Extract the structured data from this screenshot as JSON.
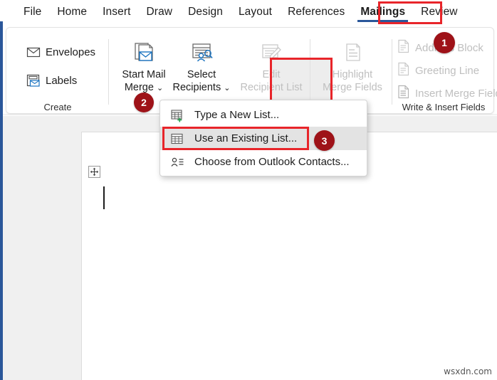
{
  "window": {
    "accent_blue": "#2b579a",
    "highlight_red": "#e8252a",
    "badge_red": "#9e1218"
  },
  "tabs": [
    {
      "label": "File",
      "active": false
    },
    {
      "label": "Home",
      "active": false
    },
    {
      "label": "Insert",
      "active": false
    },
    {
      "label": "Draw",
      "active": false
    },
    {
      "label": "Design",
      "active": false
    },
    {
      "label": "Layout",
      "active": false
    },
    {
      "label": "References",
      "active": false
    },
    {
      "label": "Mailings",
      "active": true
    },
    {
      "label": "Review",
      "active": false
    }
  ],
  "ribbon": {
    "groups": [
      {
        "name": "create",
        "label": "Create"
      },
      {
        "name": "start_mail_merge",
        "label": ""
      },
      {
        "name": "write_insert",
        "label": "Write & Insert Fields"
      }
    ],
    "envelopes": {
      "label": "Envelopes",
      "icon": "envelope-icon"
    },
    "labels": {
      "label": "Labels",
      "icon": "label-icon"
    },
    "start_mail_merge": {
      "line1": "Start Mail",
      "line2": "Merge",
      "chevron": "⌄",
      "icon": "start-mail-merge-icon"
    },
    "select_recipients": {
      "line1": "Select",
      "line2": "Recipients",
      "chevron": "⌄",
      "icon": "select-recipients-icon"
    },
    "edit_recipient_list": {
      "line1": "Edit",
      "line2": "Recipient List",
      "icon": "edit-recipient-list-icon"
    },
    "highlight_merge_fields": {
      "line1": "Highlight",
      "line2": "Merge Fields",
      "icon": "highlight-merge-fields-icon"
    },
    "address_block": {
      "label": "Address Block",
      "icon": "address-block-icon"
    },
    "greeting_line": {
      "label": "Greeting Line",
      "icon": "greeting-line-icon"
    },
    "insert_merge_field": {
      "label": "Insert Merge Field",
      "chevron": "⌄",
      "icon": "insert-merge-field-icon"
    }
  },
  "dropdown": {
    "items": [
      {
        "label": "Type a New List...",
        "icon": "new-list-icon",
        "hover": false
      },
      {
        "label": "Use an Existing List...",
        "icon": "existing-list-icon",
        "hover": true
      },
      {
        "label": "Choose from Outlook Contacts...",
        "icon": "outlook-contacts-icon",
        "hover": false
      }
    ]
  },
  "badges": [
    {
      "number": "1"
    },
    {
      "number": "2"
    },
    {
      "number": "3"
    }
  ],
  "document": {
    "move_handle": "move-handle-icon",
    "caret": "text-caret"
  },
  "watermark": {
    "text": "wsxdn.com"
  }
}
